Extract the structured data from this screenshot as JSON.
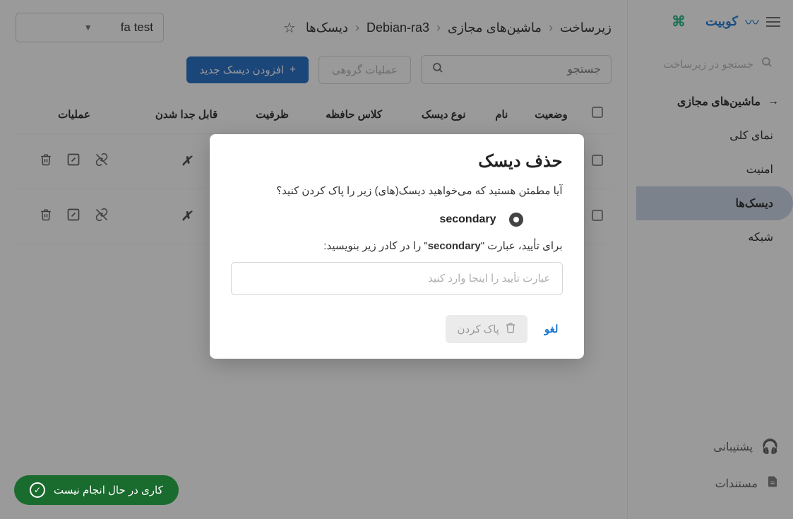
{
  "brand": {
    "name": "کوبیت"
  },
  "sidebar": {
    "searchPlaceholder": "جستجو در زیرساخت",
    "navHeader": "ماشین‌های مجازی",
    "items": [
      {
        "label": "نمای کلی"
      },
      {
        "label": "امنیت"
      },
      {
        "label": "دیسک‌ها"
      },
      {
        "label": "شبکه"
      }
    ],
    "footer": {
      "support": "پشتیبانی",
      "docs": "مستندات"
    }
  },
  "breadcrumb": {
    "a": "زیرساخت",
    "b": "ماشین‌های مجازی",
    "c": "Debian-ra3",
    "d": "دیسک‌ها"
  },
  "project": {
    "selected": "fa test"
  },
  "toolbar": {
    "searchPlaceholder": "جستجو",
    "group": "عملیات گروهی",
    "add": "افزودن دیسک جدید"
  },
  "table": {
    "headers": {
      "status": "وضعیت",
      "name": "نام",
      "diskType": "نوع دیسک",
      "storageClass": "کلاس حافظه",
      "capacity": "ظرفیت",
      "detachable": "قابل جدا شدن",
      "actions": "عملیات"
    },
    "rows": [
      {
        "detachable": "✗"
      },
      {
        "detachable": "✗"
      }
    ]
  },
  "modal": {
    "title": "حذف دیسک",
    "question": "آیا مطمئن هستید که می‌خواهید دیسک(های) زیر را پاک کردن کنید؟",
    "diskName": "secondary",
    "confirmPrefix": "برای تأیید، عبارت \"",
    "confirmSuffix": "\" را در کادر زیر بنویسید:",
    "inputPlaceholder": "عبارت تأیید را اینجا وارد کنید",
    "cancel": "لغو",
    "delete": "پاک کردن"
  },
  "status": {
    "idle": "کاری در حال انجام نیست"
  }
}
